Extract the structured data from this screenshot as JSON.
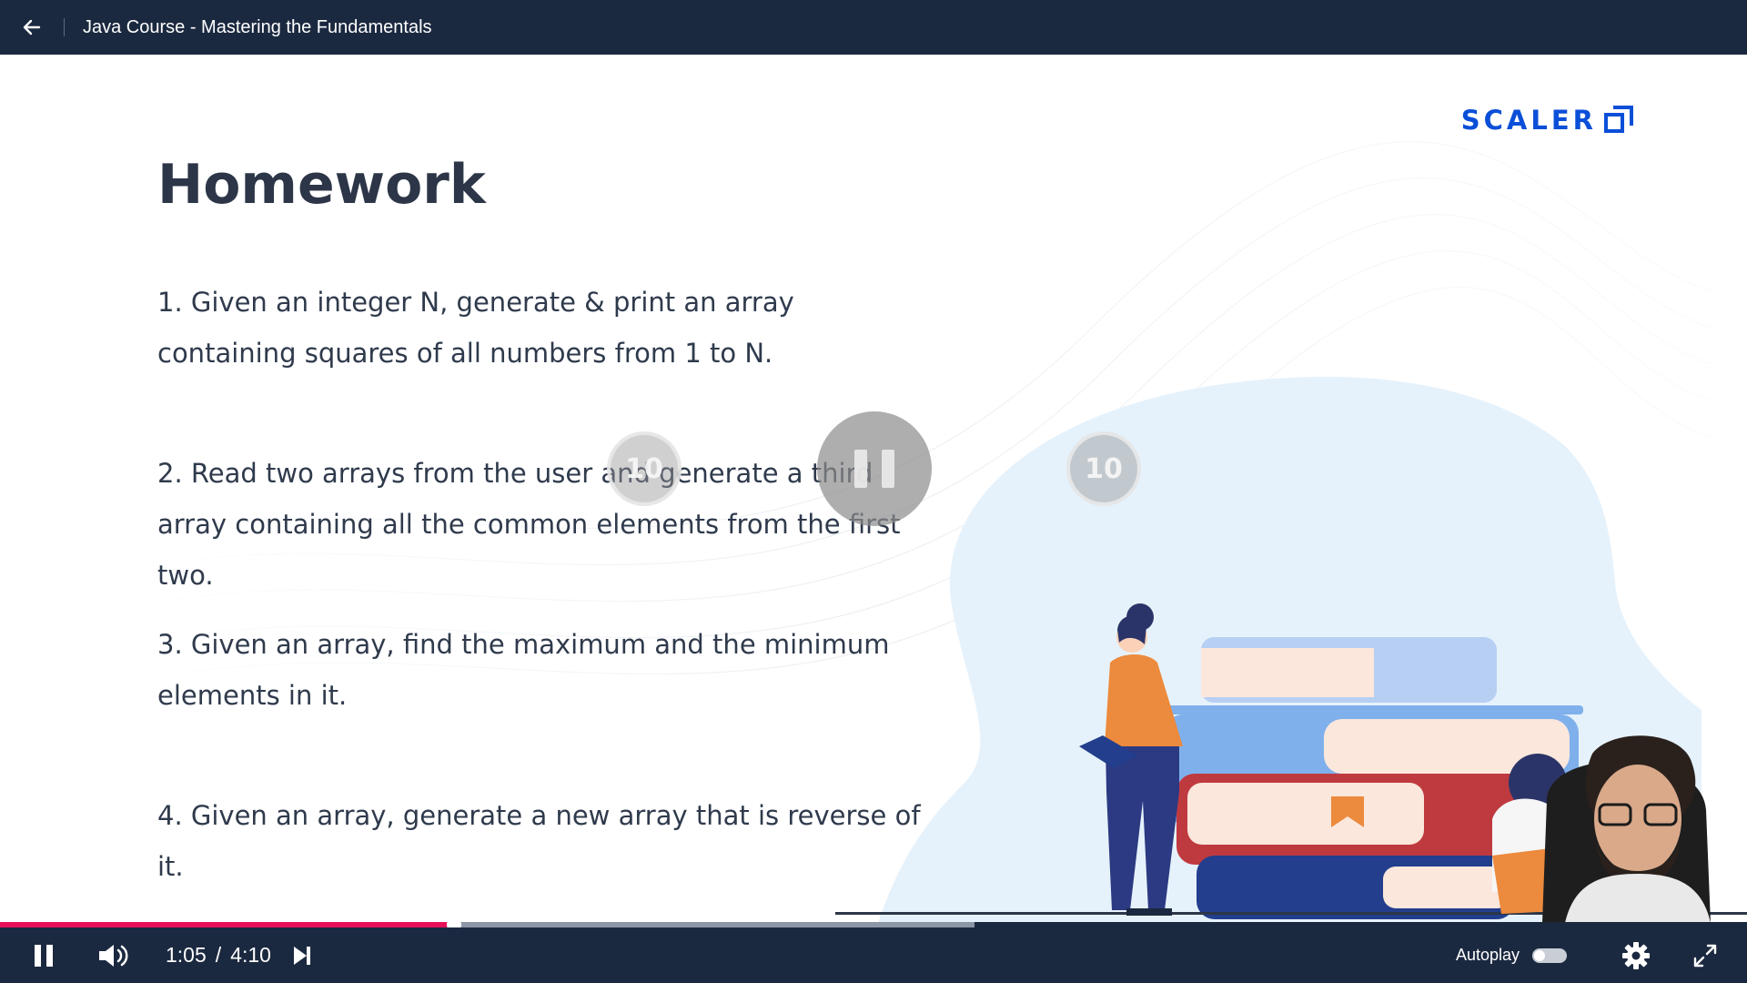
{
  "header": {
    "course_title": "Java Course - Mastering the Fundamentals"
  },
  "slide": {
    "logo_text": "SCALER",
    "title": "Homework",
    "items": [
      "1. Given an integer N, generate & print an array containing squares of all numbers from 1 to N.",
      "2. Read two arrays from the user and generate a third array containing all the common elements from the first two.",
      "3. Given an array, find the maximum and the minimum elements in it.",
      "4. Given an array, generate a new array that is reverse of it."
    ]
  },
  "overlay": {
    "rewind_seconds": "10",
    "forward_seconds": "10"
  },
  "player": {
    "current_time": "1:05",
    "separator": "/",
    "duration": "4:10",
    "progress_fraction": 0.26,
    "buffered_fraction": 0.558,
    "autoplay_label": "Autoplay",
    "autoplay_on": false,
    "accent_color": "#e8105a"
  },
  "icons": {
    "back": "arrow-left-icon",
    "pause": "pause-icon",
    "volume": "volume-icon",
    "next": "skip-next-icon",
    "settings": "gear-icon",
    "fullscreen": "expand-icon"
  }
}
